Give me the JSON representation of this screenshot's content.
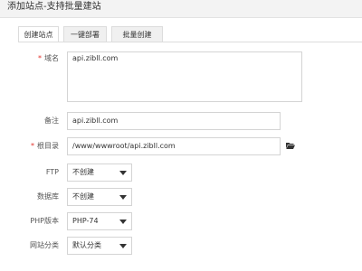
{
  "window": {
    "title": "添加站点-支持批量建站"
  },
  "tabs": [
    {
      "label": "创建站点",
      "active": true
    },
    {
      "label": "一键部署",
      "active": false
    },
    {
      "label": "批量创建",
      "active": false
    }
  ],
  "form": {
    "domain": {
      "label": "域名",
      "value": "api.zibll.com",
      "required": true
    },
    "remark": {
      "label": "备注",
      "value": "api.zibll.com"
    },
    "root": {
      "label": "根目录",
      "value": "/www/wwwroot/api.zibll.com",
      "required": true
    },
    "ftp": {
      "label": "FTP",
      "value": "不创建"
    },
    "database": {
      "label": "数据库",
      "value": "不创建"
    },
    "php": {
      "label": "PHP版本",
      "value": "PHP-74"
    },
    "category": {
      "label": "网站分类",
      "value": "默认分类"
    }
  },
  "icons": {
    "folder": "folder-open-icon",
    "caret": "chevron-down-icon"
  },
  "colors": {
    "required": "#e3322b",
    "border": "#d4d4d4"
  }
}
